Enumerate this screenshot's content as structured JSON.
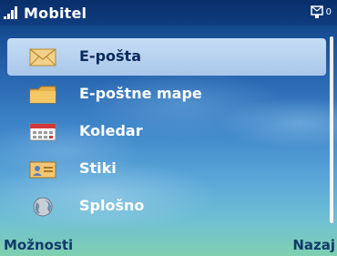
{
  "status_bar": {
    "title": "Mobitel",
    "signal_icon": "signal-strength-icon",
    "message_indicator_icon": "message-waiting-icon",
    "message_count": "0"
  },
  "menu": {
    "items": [
      {
        "label": "E-pošta",
        "icon": "envelope-icon",
        "selected": true
      },
      {
        "label": "E-poštne mape",
        "icon": "folder-icon",
        "selected": false
      },
      {
        "label": "Koledar",
        "icon": "calendar-icon",
        "selected": false
      },
      {
        "label": "Stiki",
        "icon": "contact-card-icon",
        "selected": false
      },
      {
        "label": "Splošno",
        "icon": "globe-icon",
        "selected": false
      }
    ]
  },
  "softkeys": {
    "left": "Možnosti",
    "right": "Nazaj"
  },
  "colors": {
    "status_bar": "#0f3d80",
    "selection": "#b6d0ef",
    "text": "#ffffff",
    "selected_text": "#0a2a5c",
    "softkey_text": "#123a6a"
  }
}
